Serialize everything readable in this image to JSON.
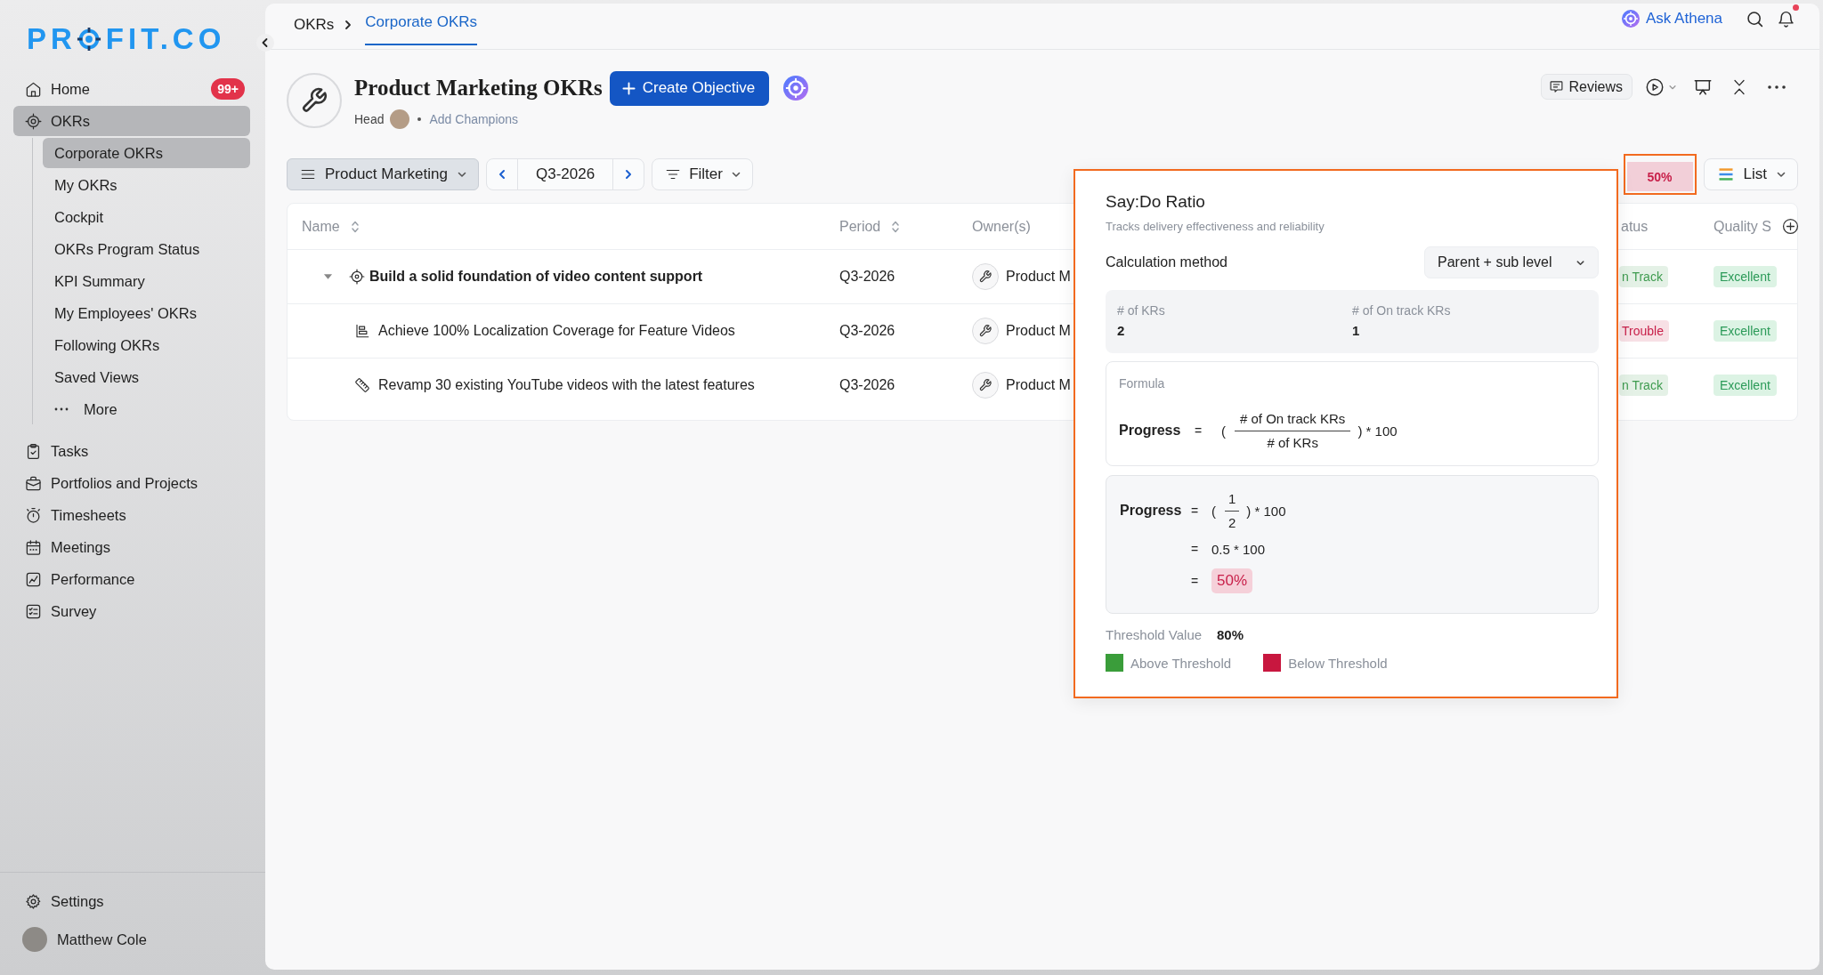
{
  "sidebar": {
    "logo": {
      "text_start": "PR",
      "text_end": "FIT.CO"
    },
    "items": [
      {
        "label": "Home",
        "badge": "99+",
        "selected": false
      },
      {
        "label": "OKRs",
        "selected": true,
        "children": [
          {
            "label": "Corporate OKRs",
            "kind": "link",
            "selected": true
          },
          {
            "label": "My OKRs",
            "kind": "link",
            "selected": false
          },
          {
            "label": "Cockpit",
            "kind": "link",
            "selected": false
          },
          {
            "label": "OKRs Program Status",
            "kind": "link",
            "selected": false
          },
          {
            "label": "KPI Summary",
            "kind": "link",
            "selected": false
          },
          {
            "label": "My Employees' OKRs",
            "kind": "link",
            "selected": false
          },
          {
            "label": "Following OKRs",
            "kind": "link",
            "selected": false
          },
          {
            "label": "Saved Views",
            "kind": "link",
            "selected": false
          },
          {
            "label": "More",
            "kind": "more",
            "selected": false
          }
        ]
      },
      {
        "label": "Tasks",
        "selected": false
      },
      {
        "label": "Portfolios and Projects",
        "selected": false
      },
      {
        "label": "Timesheets",
        "selected": false
      },
      {
        "label": "Meetings",
        "selected": false
      },
      {
        "label": "Performance",
        "selected": false
      },
      {
        "label": "Survey",
        "selected": false
      }
    ],
    "footer": {
      "settings": "Settings",
      "user": "Matthew Cole"
    }
  },
  "topbar": {
    "breadcrumbs": [
      {
        "label": "OKRs",
        "selected": false
      },
      {
        "label": "Corporate OKRs",
        "selected": true
      }
    ],
    "ask_athena": "Ask Athena",
    "has_unread": true
  },
  "header": {
    "title": "Product Marketing OKRs",
    "create_button": "Create Objective",
    "head_label": "Head",
    "add_champions": "Add Champions",
    "reviews_button": "Reviews"
  },
  "toolbar": {
    "department": "Product Marketing",
    "period": "Q3-2026",
    "filter": "Filter",
    "say_do_badge": {
      "text": "50%",
      "highlighted": true
    },
    "view": "List"
  },
  "table": {
    "columns": [
      {
        "label": "Name",
        "sortable": true
      },
      {
        "label": "Period",
        "sortable": true
      },
      {
        "label": "Owner(s)",
        "sortable": false
      },
      {
        "label": "atus",
        "sortable": false
      },
      {
        "label": "Quality S",
        "sortable": false
      }
    ],
    "rows": [
      {
        "name": "Build a solid foundation of video content support",
        "period": "Q3-2026",
        "owner": "Product M",
        "status": {
          "text": "n Track",
          "color": "#3e9b4f"
        },
        "quality": "Excellent",
        "expanded": true,
        "children": [
          {
            "kind": "metric",
            "name": "Achieve 100% Localization Coverage for Feature Videos",
            "period": "Q3-2026",
            "owner": "Product M",
            "status": {
              "text": "Trouble",
              "color": "#c8204a"
            },
            "quality": "Excellent"
          },
          {
            "kind": "ruler",
            "name": "Revamp 30 existing YouTube videos with the latest features",
            "period": "Q3-2026",
            "owner": "Product M",
            "status": {
              "text": "n Track",
              "color": "#3e9b4f"
            },
            "quality": "Excellent"
          }
        ]
      }
    ]
  },
  "say_do_panel": {
    "highlighted": true,
    "title": "Say:Do Ratio",
    "subtitle": "Tracks delivery effectiveness and reliability",
    "method_label": "Calculation method",
    "method_value": "Parent + sub level",
    "stats": [
      {
        "label": "# of KRs",
        "value": "2"
      },
      {
        "label": "# of On track KRs",
        "value": "1"
      }
    ],
    "formula": {
      "label": "Formula",
      "lhs": "Progress",
      "eq": "=",
      "open": "(",
      "numerator": "# of On track KRs",
      "denominator": "# of KRs",
      "close": ") * 100"
    },
    "steps": [
      {
        "kind": "fraction",
        "lhs": "Progress",
        "eq": "=",
        "open": "(",
        "numerator": "1",
        "denominator": "2",
        "close": ") * 100"
      },
      {
        "kind": "text",
        "eq": "=",
        "value": "0.5 * 100"
      },
      {
        "kind": "result",
        "eq": "=",
        "value": "50%"
      }
    ],
    "threshold": {
      "label": "Threshold Value",
      "value": "80%"
    },
    "legend": [
      {
        "label": "Above Threshold",
        "color": "#3a9d3a"
      },
      {
        "label": "Below Threshold",
        "color": "#c8173f"
      }
    ]
  }
}
